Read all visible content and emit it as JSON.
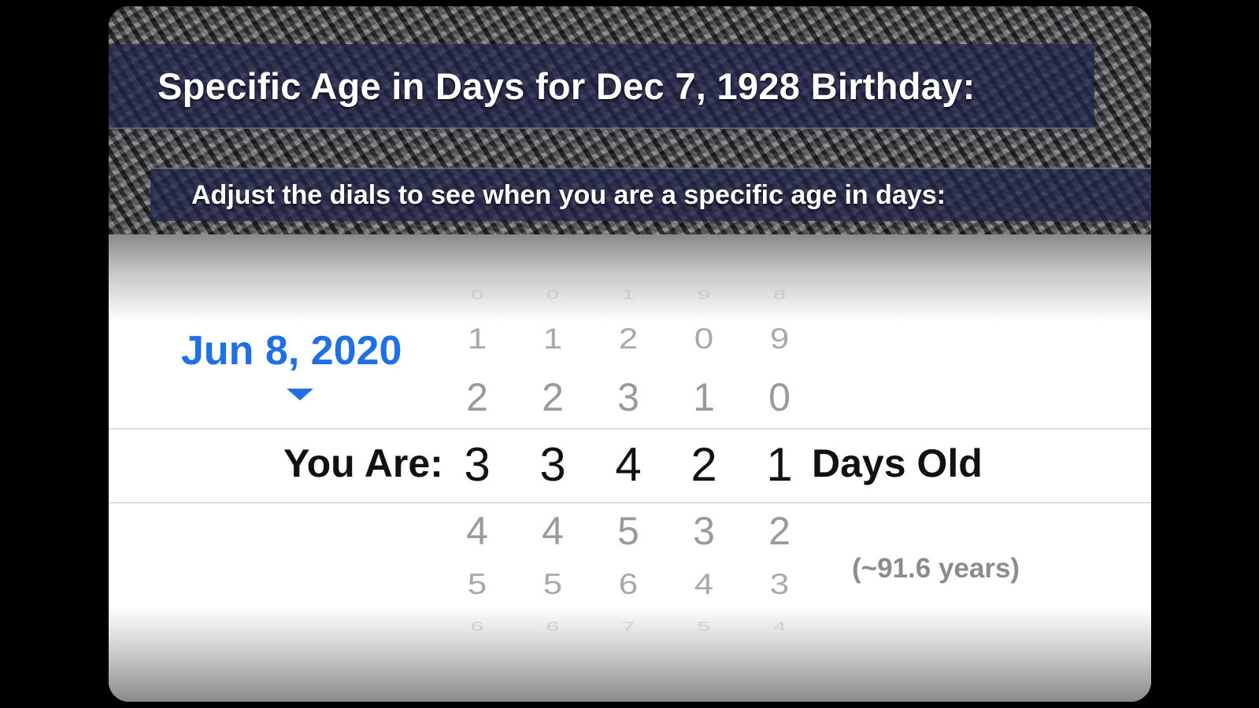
{
  "header": {
    "title": "Specific Age in Days for Dec 7, 1928 Birthday:",
    "subtitle": "Adjust the dials to see when you are a specific age in days:"
  },
  "date_button": {
    "label": "Jun 8, 2020",
    "icon": "caret-down-icon"
  },
  "row_label": "You Are:",
  "unit_label": "Days Old",
  "years_note": "(~91.6 years)",
  "wheels": [
    {
      "digits": [
        "0",
        "1",
        "2",
        "3",
        "4",
        "5",
        "6"
      ],
      "selected": "3"
    },
    {
      "digits": [
        "0",
        "1",
        "2",
        "3",
        "4",
        "5",
        "6"
      ],
      "selected": "3"
    },
    {
      "digits": [
        "1",
        "2",
        "3",
        "4",
        "5",
        "6",
        "7"
      ],
      "selected": "4"
    },
    {
      "digits": [
        "9",
        "0",
        "1",
        "2",
        "3",
        "4",
        "5"
      ],
      "selected": "2"
    },
    {
      "digits": [
        "8",
        "9",
        "0",
        "1",
        "2",
        "3",
        "4"
      ],
      "selected": "1"
    }
  ],
  "colors": {
    "accent": "#1f6fe6",
    "banner": "#1e244b"
  }
}
